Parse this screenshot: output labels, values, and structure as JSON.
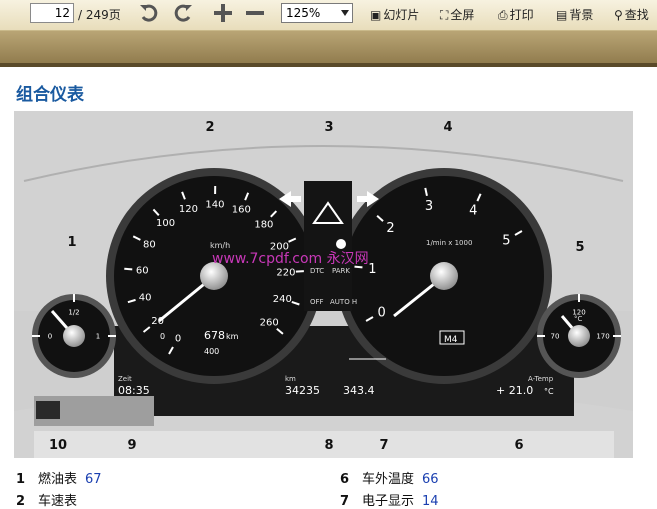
{
  "toolbar": {
    "page_current": "12",
    "page_total": "/ 249页",
    "zoom": "125%",
    "slideshow_label": "幻灯片",
    "fullscreen_label": "全屏",
    "print_label": "打印",
    "background_label": "背景",
    "search_label": "查找"
  },
  "section_title": "组合仪表",
  "figure": {
    "callouts": [
      "1",
      "2",
      "3",
      "4",
      "5",
      "6",
      "7",
      "8",
      "9",
      "10"
    ],
    "speedo_ticks": [
      "0",
      "20",
      "40",
      "60",
      "80",
      "100",
      "120",
      "140",
      "160",
      "180",
      "200",
      "220",
      "240",
      "260"
    ],
    "speedo_unit": "km/h",
    "tacho_ticks": [
      "0",
      "1",
      "2",
      "3",
      "4",
      "5"
    ],
    "tacho_unit": "1/min x 1000",
    "fuel_ticks": [
      "0",
      "1/2",
      "1"
    ],
    "temp_ticks": [
      "70",
      "120",
      "170"
    ],
    "temp_unit": "°C",
    "range_value": "678",
    "range_unit": "km",
    "range_ticks": [
      "0",
      "400"
    ],
    "gear": "M4",
    "dtc_label": "DTC",
    "off_label": "OFF",
    "park_label": "PARK",
    "autoh_label": "AUTO H",
    "time_label": "Zeit",
    "time_value": "08:35",
    "odo_label": "km",
    "odo_value": "34235",
    "trip_value": "343.4",
    "temp_label": "A-Temp",
    "temp_value": "+ 21.0",
    "temp_value_unit": "°C",
    "watermark": "www.7cpdf.com 永汉网"
  },
  "legend": [
    {
      "num": "1",
      "text": "燃油表",
      "page": "67"
    },
    {
      "num": "2",
      "text": "车速表",
      "page": ""
    },
    {
      "num": "6",
      "text": "车外温度",
      "page": "66"
    },
    {
      "num": "7",
      "text": "电子显示",
      "page": "14"
    }
  ]
}
